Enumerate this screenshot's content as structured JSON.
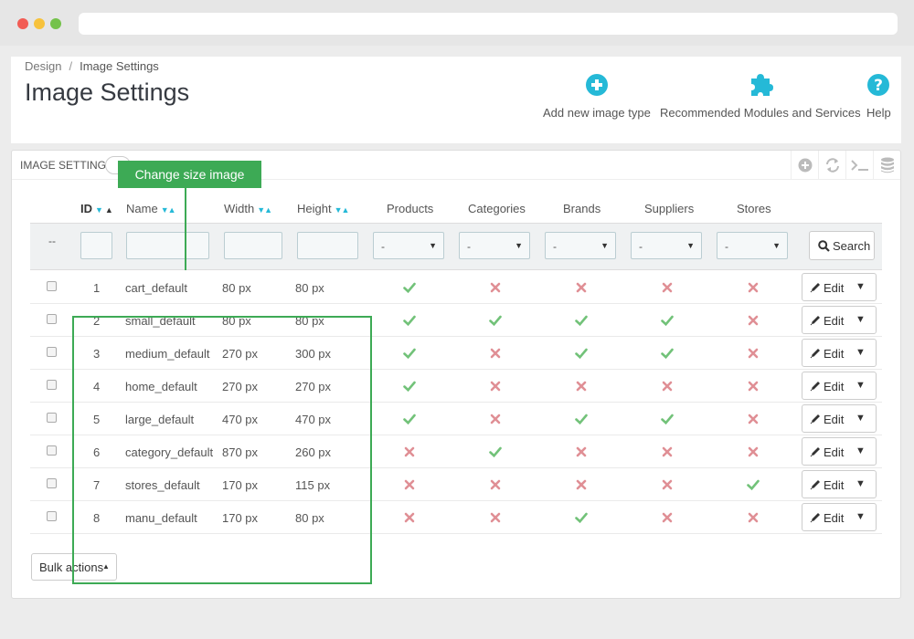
{
  "breadcrumb": {
    "parent": "Design",
    "separator": "/",
    "current": "Image Settings"
  },
  "page_title": "Image Settings",
  "toolbar": [
    {
      "label": "Add new image type",
      "icon": "plus-circle-icon"
    },
    {
      "label": "Recommended Modules and Services",
      "icon": "puzzle-icon"
    },
    {
      "label": "Help",
      "icon": "help-circle-icon"
    }
  ],
  "panel": {
    "title": "IMAGE SETTINGS",
    "tooltip": "Change size image",
    "tools": [
      "add-icon",
      "refresh-icon",
      "terminal-icon",
      "database-icon"
    ]
  },
  "columns": {
    "id": "ID",
    "name": "Name",
    "width": "Width",
    "height": "Height",
    "products": "Products",
    "categories": "Categories",
    "brands": "Brands",
    "suppliers": "Suppliers",
    "stores": "Stores"
  },
  "filters": {
    "dash": "--",
    "select_value": "-",
    "search_label": "Search"
  },
  "rows": [
    {
      "id": "1",
      "name": "cart_default",
      "width": "80 px",
      "height": "80 px",
      "flags": [
        true,
        false,
        false,
        false,
        false
      ]
    },
    {
      "id": "2",
      "name": "small_default",
      "width": "80 px",
      "height": "80 px",
      "flags": [
        true,
        true,
        true,
        true,
        false
      ]
    },
    {
      "id": "3",
      "name": "medium_default",
      "width": "270 px",
      "height": "300 px",
      "flags": [
        true,
        false,
        true,
        true,
        false
      ]
    },
    {
      "id": "4",
      "name": "home_default",
      "width": "270 px",
      "height": "270 px",
      "flags": [
        true,
        false,
        false,
        false,
        false
      ]
    },
    {
      "id": "5",
      "name": "large_default",
      "width": "470 px",
      "height": "470 px",
      "flags": [
        true,
        false,
        true,
        true,
        false
      ]
    },
    {
      "id": "6",
      "name": "category_default",
      "width": "870 px",
      "height": "260 px",
      "flags": [
        false,
        true,
        false,
        false,
        false
      ]
    },
    {
      "id": "7",
      "name": "stores_default",
      "width": "170 px",
      "height": "115 px",
      "flags": [
        false,
        false,
        false,
        false,
        true
      ]
    },
    {
      "id": "8",
      "name": "manu_default",
      "width": "170 px",
      "height": "80 px",
      "flags": [
        false,
        false,
        true,
        false,
        false
      ]
    }
  ],
  "row_action": "Edit",
  "bulk_actions": "Bulk actions",
  "colors": {
    "accent": "#25b9d7",
    "check": "#72c279",
    "cross": "#e08f95",
    "highlight": "#3daa55"
  }
}
